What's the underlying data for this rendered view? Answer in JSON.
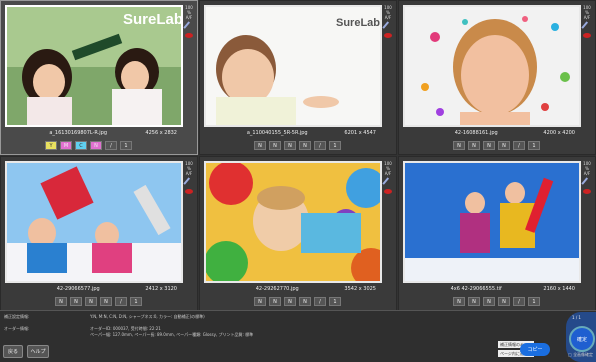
{
  "cells": [
    {
      "name": "a_16130169807L-R.jpg",
      "size": "4256 x 2832",
      "side_pct": "100 %",
      "side_af": "A/F",
      "logo": "SureLab"
    },
    {
      "name": "a_110040155_5R-5R.jpg",
      "size": "6201 x 4547",
      "side_pct": "100 %",
      "side_af": "A/F",
      "logo": "SureLab"
    },
    {
      "name": "42-16088161.jpg",
      "size": "4200 x 4200",
      "side_pct": "100 %",
      "side_af": "A/F",
      "logo": ""
    },
    {
      "name": "42-29066577.jpg",
      "size": "2412 x 3120",
      "side_pct": "100 %",
      "side_af": "A/F",
      "logo": ""
    },
    {
      "name": "42-29262770.jpg",
      "size": "3542 x 3025",
      "side_pct": "100 %",
      "side_af": "A/F",
      "logo": ""
    },
    {
      "name": "4x6 42-29066555.tif",
      "size": "2160 x 1440",
      "side_pct": "100 %",
      "side_af": "A/F",
      "logo": ""
    }
  ],
  "cb": {
    "n": "N",
    "one": "1",
    "y": "Y",
    "m": "M",
    "c": "C"
  },
  "info": {
    "l1": "補正設定情報:",
    "v1": "Y:N, M:N, C:N, D:N, シャープネス:0, カラー: 自動補正(の標準)",
    "l2": "オーダー情報:",
    "v2": "オーダーID: 000037, 受付時間: 22:21",
    "v3": "ペーパー幅: 127.0mm, ペーパー長: 89.0mm, ペーパー種類: Glossy, プリント品質: 標準"
  },
  "buttons": {
    "back": "戻る",
    "help": "ヘルプ",
    "copy": "コピー",
    "confirm": "確定"
  },
  "selects": {
    "s1": "補正情報のみ",
    "s2": "ページ内に適用"
  },
  "counter": "1 / 1",
  "check": "全画像確定"
}
